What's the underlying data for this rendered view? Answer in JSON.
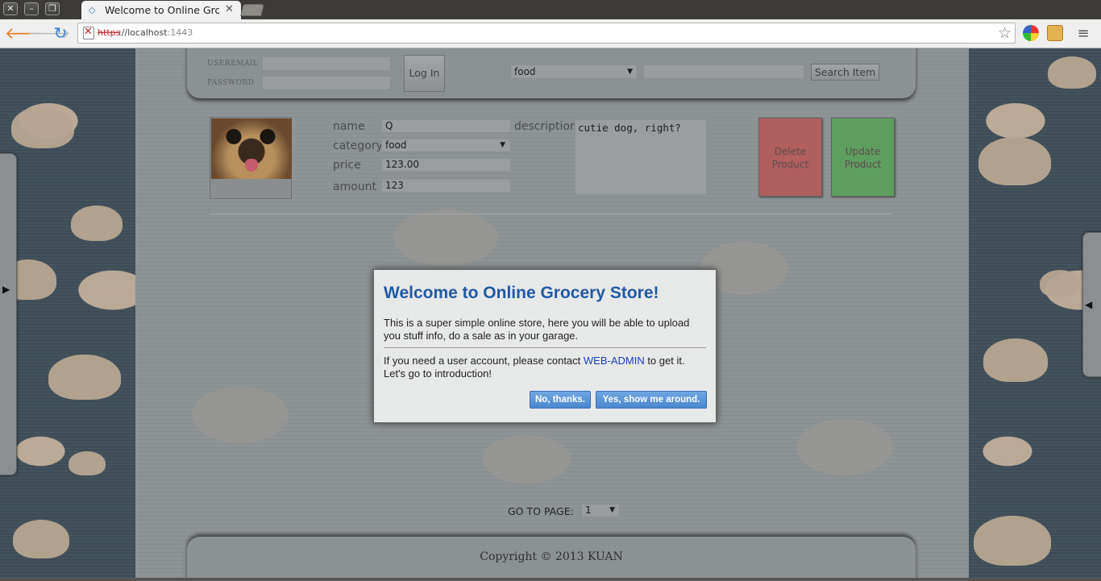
{
  "window": {
    "tab_title": "Welcome to Online Groce",
    "url_scheme": "https",
    "url_sep": "://",
    "url_host": "localhost",
    "url_port": ":1443"
  },
  "header": {
    "email_label": "USEREMAIL",
    "password_label": "PASSWORD",
    "login_label": "Log In",
    "category_selected": "food",
    "search_button_label": "Search Item"
  },
  "product": {
    "name_label": "name",
    "name_value": "Q",
    "category_label": "category",
    "category_value": "food",
    "price_label": "price",
    "price_value": "123.00",
    "amount_label": "amount",
    "amount_value": "123",
    "description_label": "description",
    "description_value": "cutie dog, right?",
    "delete_label": "Delete Product",
    "update_label": "Update Product",
    "delete_color": "#b05e5e",
    "update_color": "#5e9e5e"
  },
  "pagination": {
    "label": "GO TO PAGE:",
    "selected": "1"
  },
  "footer": {
    "copyright": "Copyright © 2013 KUAN"
  },
  "modal": {
    "title": "Welcome to Online Grocery Store!",
    "paragraph1": "This is a super simple online store, here you will be able to upload you stuff info, do a sale as in your garage.",
    "paragraph2_before": "If you need a user account, please contact ",
    "admin_link": "WEB-ADMIN",
    "paragraph2_after": " to get it.",
    "paragraph3": "Let's go to introduction!",
    "no_button": "No, thanks.",
    "yes_button": "Yes, show me around.",
    "title_color": "#1f5aa6"
  }
}
